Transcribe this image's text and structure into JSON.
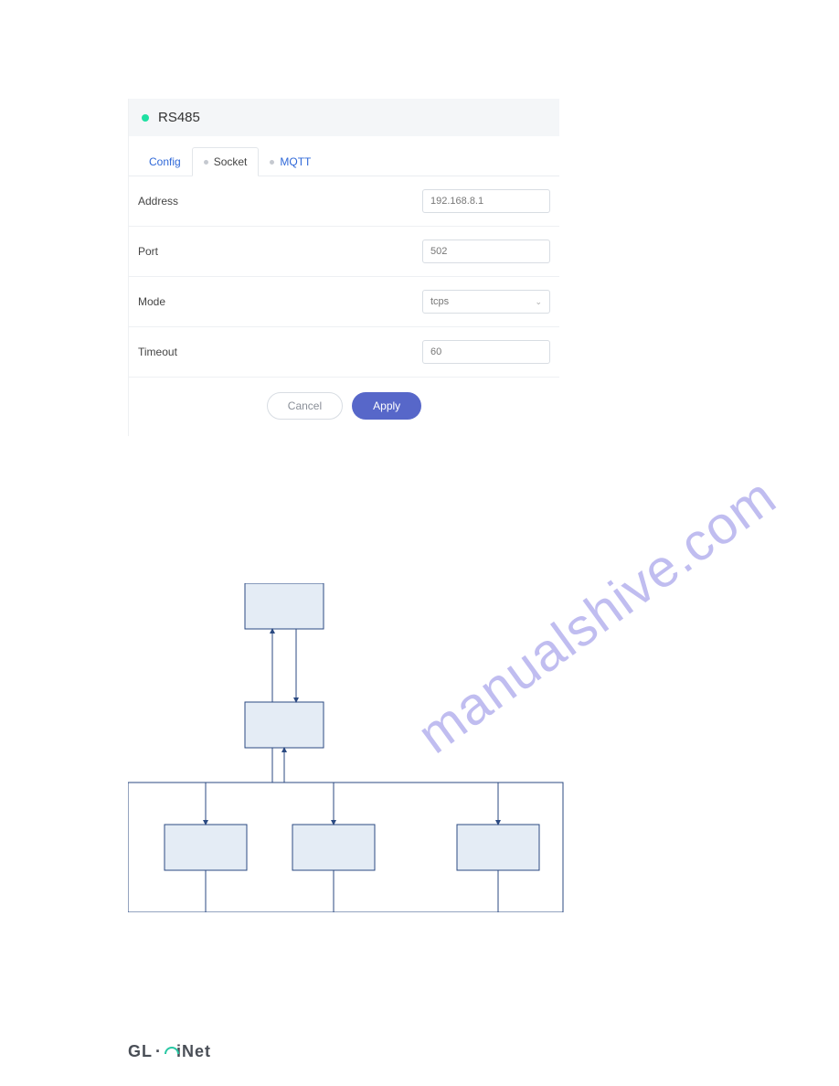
{
  "panel": {
    "title": "RS485",
    "tabs": {
      "config": "Config",
      "socket": "Socket",
      "mqtt": "MQTT"
    },
    "fields": {
      "address": {
        "label": "Address",
        "value": "192.168.8.1"
      },
      "port": {
        "label": "Port",
        "value": "502"
      },
      "mode": {
        "label": "Mode",
        "value": "tcps"
      },
      "timeout": {
        "label": "Timeout",
        "value": "60"
      }
    },
    "buttons": {
      "cancel": "Cancel",
      "apply": "Apply"
    }
  },
  "watermark": "manualshive.com",
  "logo": {
    "left": "GL",
    "right": "iNet"
  }
}
